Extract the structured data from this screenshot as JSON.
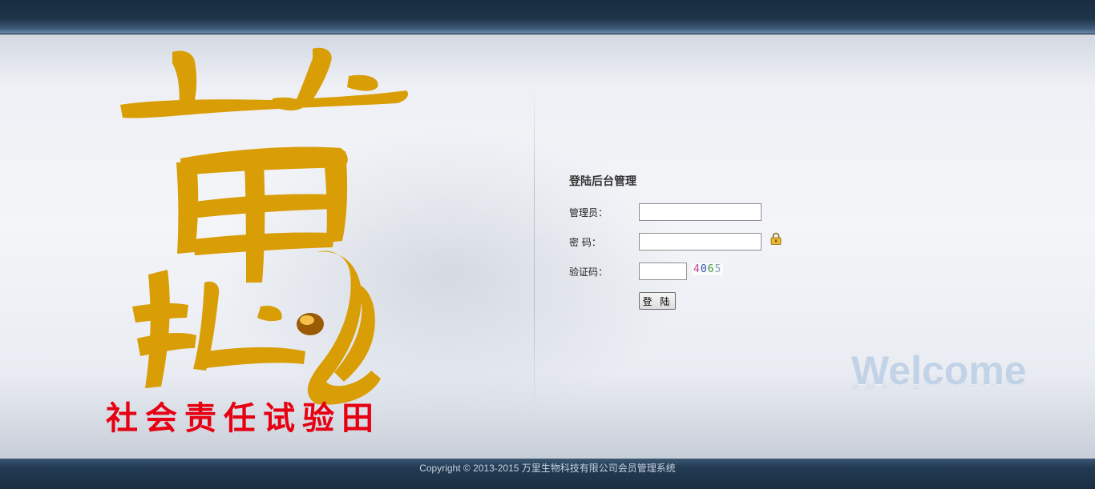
{
  "branding": {
    "calligraphy_char": "萬",
    "slogan": "社会责任试验田"
  },
  "login": {
    "title": "登陆后台管理",
    "admin_label": "管理员：",
    "admin_value": "",
    "password_label": "密 码：",
    "password_value": "",
    "captcha_label": "验证码：",
    "captcha_value": "",
    "captcha_chars": [
      "4",
      "0",
      "6",
      "5"
    ],
    "submit_label": "登 陆"
  },
  "welcome_text": "Welcome",
  "footer": {
    "copyright": "Copyright © 2013-2015 万里生物科技有限公司会员管理系统"
  },
  "colors": {
    "header_bg": "#1e3449",
    "calligraphy": "#d99d06",
    "slogan": "#e60012",
    "welcome": "#b9cde4"
  }
}
